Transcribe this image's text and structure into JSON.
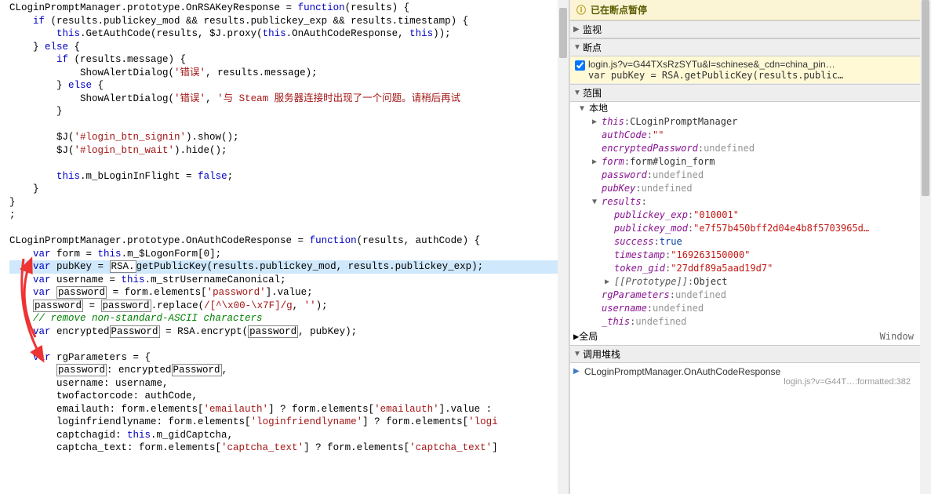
{
  "code": {
    "lines": [
      {
        "indent": 0,
        "segments": [
          {
            "t": "CLoginPromptManager.prototype.OnRSAKeyResponse = "
          },
          {
            "t": "function",
            "c": "kw"
          },
          {
            "t": "(results) {"
          }
        ]
      },
      {
        "indent": 1,
        "segments": [
          {
            "t": "if",
            "c": "kw"
          },
          {
            "t": " (results.publickey_mod && results.publickey_exp && results.timestamp) {"
          }
        ]
      },
      {
        "indent": 2,
        "segments": [
          {
            "t": "this",
            "c": "kw"
          },
          {
            "t": ".GetAuthCode(results, $J.proxy("
          },
          {
            "t": "this",
            "c": "kw"
          },
          {
            "t": ".OnAuthCodeResponse, "
          },
          {
            "t": "this",
            "c": "kw"
          },
          {
            "t": "));"
          }
        ]
      },
      {
        "indent": 1,
        "segments": [
          {
            "t": "} "
          },
          {
            "t": "else",
            "c": "kw"
          },
          {
            "t": " {"
          }
        ]
      },
      {
        "indent": 2,
        "segments": [
          {
            "t": "if",
            "c": "kw"
          },
          {
            "t": " (results.message) {"
          }
        ]
      },
      {
        "indent": 3,
        "segments": [
          {
            "t": "ShowAlertDialog("
          },
          {
            "t": "'错误'",
            "c": "str"
          },
          {
            "t": ", results.message);"
          }
        ]
      },
      {
        "indent": 2,
        "segments": [
          {
            "t": "} "
          },
          {
            "t": "else",
            "c": "kw"
          },
          {
            "t": " {"
          }
        ]
      },
      {
        "indent": 3,
        "segments": [
          {
            "t": "ShowAlertDialog("
          },
          {
            "t": "'错误'",
            "c": "str"
          },
          {
            "t": ", "
          },
          {
            "t": "'与 Steam 服务器连接时出现了一个问题。请稍后再试",
            "c": "str"
          }
        ]
      },
      {
        "indent": 2,
        "segments": [
          {
            "t": "}"
          }
        ]
      },
      {
        "indent": 0,
        "segments": [
          {
            "t": ""
          }
        ]
      },
      {
        "indent": 2,
        "segments": [
          {
            "t": "$J("
          },
          {
            "t": "'#login_btn_signin'",
            "c": "str"
          },
          {
            "t": ").show();"
          }
        ]
      },
      {
        "indent": 2,
        "segments": [
          {
            "t": "$J("
          },
          {
            "t": "'#login_btn_wait'",
            "c": "str"
          },
          {
            "t": ").hide();"
          }
        ]
      },
      {
        "indent": 0,
        "segments": [
          {
            "t": ""
          }
        ]
      },
      {
        "indent": 2,
        "segments": [
          {
            "t": "this",
            "c": "kw"
          },
          {
            "t": ".m_bLoginInFlight = "
          },
          {
            "t": "false",
            "c": "kw"
          },
          {
            "t": ";"
          }
        ]
      },
      {
        "indent": 1,
        "segments": [
          {
            "t": "}"
          }
        ]
      },
      {
        "indent": 0,
        "segments": [
          {
            "t": "}"
          }
        ]
      },
      {
        "indent": 0,
        "segments": [
          {
            "t": ";"
          }
        ]
      },
      {
        "indent": 0,
        "segments": [
          {
            "t": ""
          }
        ]
      },
      {
        "indent": 0,
        "segments": [
          {
            "t": "CLoginPromptManager.prototype.OnAuthCodeResponse = "
          },
          {
            "t": "function",
            "c": "kw"
          },
          {
            "t": "(results, authCode) {"
          }
        ]
      },
      {
        "indent": 1,
        "segments": [
          {
            "t": "var",
            "c": "kw"
          },
          {
            "t": " form = "
          },
          {
            "t": "this",
            "c": "kw"
          },
          {
            "t": ".m_$LogonForm["
          },
          {
            "t": "0",
            "c": "num"
          },
          {
            "t": "];"
          }
        ]
      },
      {
        "indent": 1,
        "highlight": true,
        "segments": [
          {
            "t": "var",
            "c": "kw"
          },
          {
            "t": " pubKey = "
          },
          {
            "t": "RSA.",
            "box": true
          },
          {
            "t": "getPublicKey(results.publickey_mod, results.publickey_exp);"
          }
        ]
      },
      {
        "indent": 1,
        "segments": [
          {
            "t": "var",
            "c": "kw"
          },
          {
            "t": " username = "
          },
          {
            "t": "this",
            "c": "kw"
          },
          {
            "t": ".m_strUsernameCanonical;"
          }
        ]
      },
      {
        "indent": 1,
        "segments": [
          {
            "t": "var",
            "c": "kw"
          },
          {
            "t": " "
          },
          {
            "t": "password",
            "box": true
          },
          {
            "t": " = form.elements["
          },
          {
            "t": "'password'",
            "c": "str"
          },
          {
            "t": "].value;"
          }
        ]
      },
      {
        "indent": 1,
        "segments": [
          {
            "t": "password",
            "box": true
          },
          {
            "t": " = "
          },
          {
            "t": "password",
            "box": true
          },
          {
            "t": ".replace("
          },
          {
            "t": "/[^\\x00-\\x7F]/g",
            "c": "regex"
          },
          {
            "t": ", "
          },
          {
            "t": "''",
            "c": "str"
          },
          {
            "t": ");"
          }
        ]
      },
      {
        "indent": 1,
        "segments": [
          {
            "t": "// remove non-standard-ASCII characters",
            "c": "comment"
          }
        ]
      },
      {
        "indent": 1,
        "segments": [
          {
            "t": "var",
            "c": "kw"
          },
          {
            "t": " encrypted"
          },
          {
            "t": "Password",
            "box": true
          },
          {
            "t": " = RSA.encrypt("
          },
          {
            "t": "password",
            "box": true
          },
          {
            "t": ", pubKey);"
          }
        ]
      },
      {
        "indent": 0,
        "segments": [
          {
            "t": ""
          }
        ]
      },
      {
        "indent": 1,
        "segments": [
          {
            "t": "var",
            "c": "kw"
          },
          {
            "t": " rgParameters = {"
          }
        ]
      },
      {
        "indent": 2,
        "segments": [
          {
            "t": "password",
            "box": true
          },
          {
            "t": ": encrypted"
          },
          {
            "t": "Password",
            "box": true
          },
          {
            "t": ","
          }
        ]
      },
      {
        "indent": 2,
        "segments": [
          {
            "t": "username: username,"
          }
        ]
      },
      {
        "indent": 2,
        "segments": [
          {
            "t": "twofactorcode: authCode,"
          }
        ]
      },
      {
        "indent": 2,
        "segments": [
          {
            "t": "emailauth: form.elements["
          },
          {
            "t": "'emailauth'",
            "c": "str"
          },
          {
            "t": "] ? form.elements["
          },
          {
            "t": "'emailauth'",
            "c": "str"
          },
          {
            "t": "].value :"
          }
        ]
      },
      {
        "indent": 2,
        "segments": [
          {
            "t": "loginfriendlyname: form.elements["
          },
          {
            "t": "'loginfriendlyname'",
            "c": "str"
          },
          {
            "t": "] ? form.elements["
          },
          {
            "t": "'logi",
            "c": "str"
          }
        ]
      },
      {
        "indent": 2,
        "segments": [
          {
            "t": "captchagid: "
          },
          {
            "t": "this",
            "c": "kw"
          },
          {
            "t": ".m_gidCaptcha,"
          }
        ]
      },
      {
        "indent": 2,
        "segments": [
          {
            "t": "captcha_text: form.elements["
          },
          {
            "t": "'captcha_text'",
            "c": "str"
          },
          {
            "t": "] ? form.elements["
          },
          {
            "t": "'captcha_text'",
            "c": "str"
          },
          {
            "t": "]"
          }
        ]
      }
    ]
  },
  "debugger": {
    "paused_label": "已在断点暂停",
    "sections": {
      "watch": "监视",
      "breakpoints": "断点",
      "scope": "范围",
      "local": "本地",
      "global": "全局",
      "callstack": "调用堆栈"
    },
    "breakpoint": {
      "file": "login.js?v=G44TXsRzSYTu&l=schinese&_cdn=china_pin…",
      "code": "var pubKey = RSA.getPublicKey(results.public…"
    },
    "local_vars": [
      {
        "name": "this",
        "value": "CLoginPromptManager",
        "type": "obj",
        "expandable": true,
        "expanded": false
      },
      {
        "name": "authCode",
        "value": "\"\"",
        "type": "str"
      },
      {
        "name": "encryptedPassword",
        "value": "undefined",
        "type": "undef"
      },
      {
        "name": "form",
        "value": "form#login_form",
        "type": "obj",
        "expandable": true,
        "expanded": false
      },
      {
        "name": "password",
        "value": "undefined",
        "type": "undef"
      },
      {
        "name": "pubKey",
        "value": "undefined",
        "type": "undef"
      },
      {
        "name": "results",
        "value": "",
        "type": "obj",
        "expandable": true,
        "expanded": true,
        "children": [
          {
            "name": "publickey_exp",
            "value": "\"010001\"",
            "type": "str"
          },
          {
            "name": "publickey_mod",
            "value": "\"e7f57b450bff2d04e4b8f5703965d…",
            "type": "str"
          },
          {
            "name": "success",
            "value": "true",
            "type": "bool"
          },
          {
            "name": "timestamp",
            "value": "\"169263150000\"",
            "type": "str"
          },
          {
            "name": "token_gid",
            "value": "\"27ddf89a5aad19d7\"",
            "type": "str"
          },
          {
            "name": "[[Prototype]]",
            "value": "Object",
            "type": "proto",
            "expandable": true
          }
        ]
      },
      {
        "name": "rgParameters",
        "value": "undefined",
        "type": "undef"
      },
      {
        "name": "username",
        "value": "undefined",
        "type": "undef"
      },
      {
        "name": "_this",
        "value": "undefined",
        "type": "undef"
      }
    ],
    "global_value": "Window",
    "callstack": {
      "func": "CLoginPromptManager.OnAuthCodeResponse",
      "loc": "login.js?v=G44T…:formatted:382"
    }
  }
}
